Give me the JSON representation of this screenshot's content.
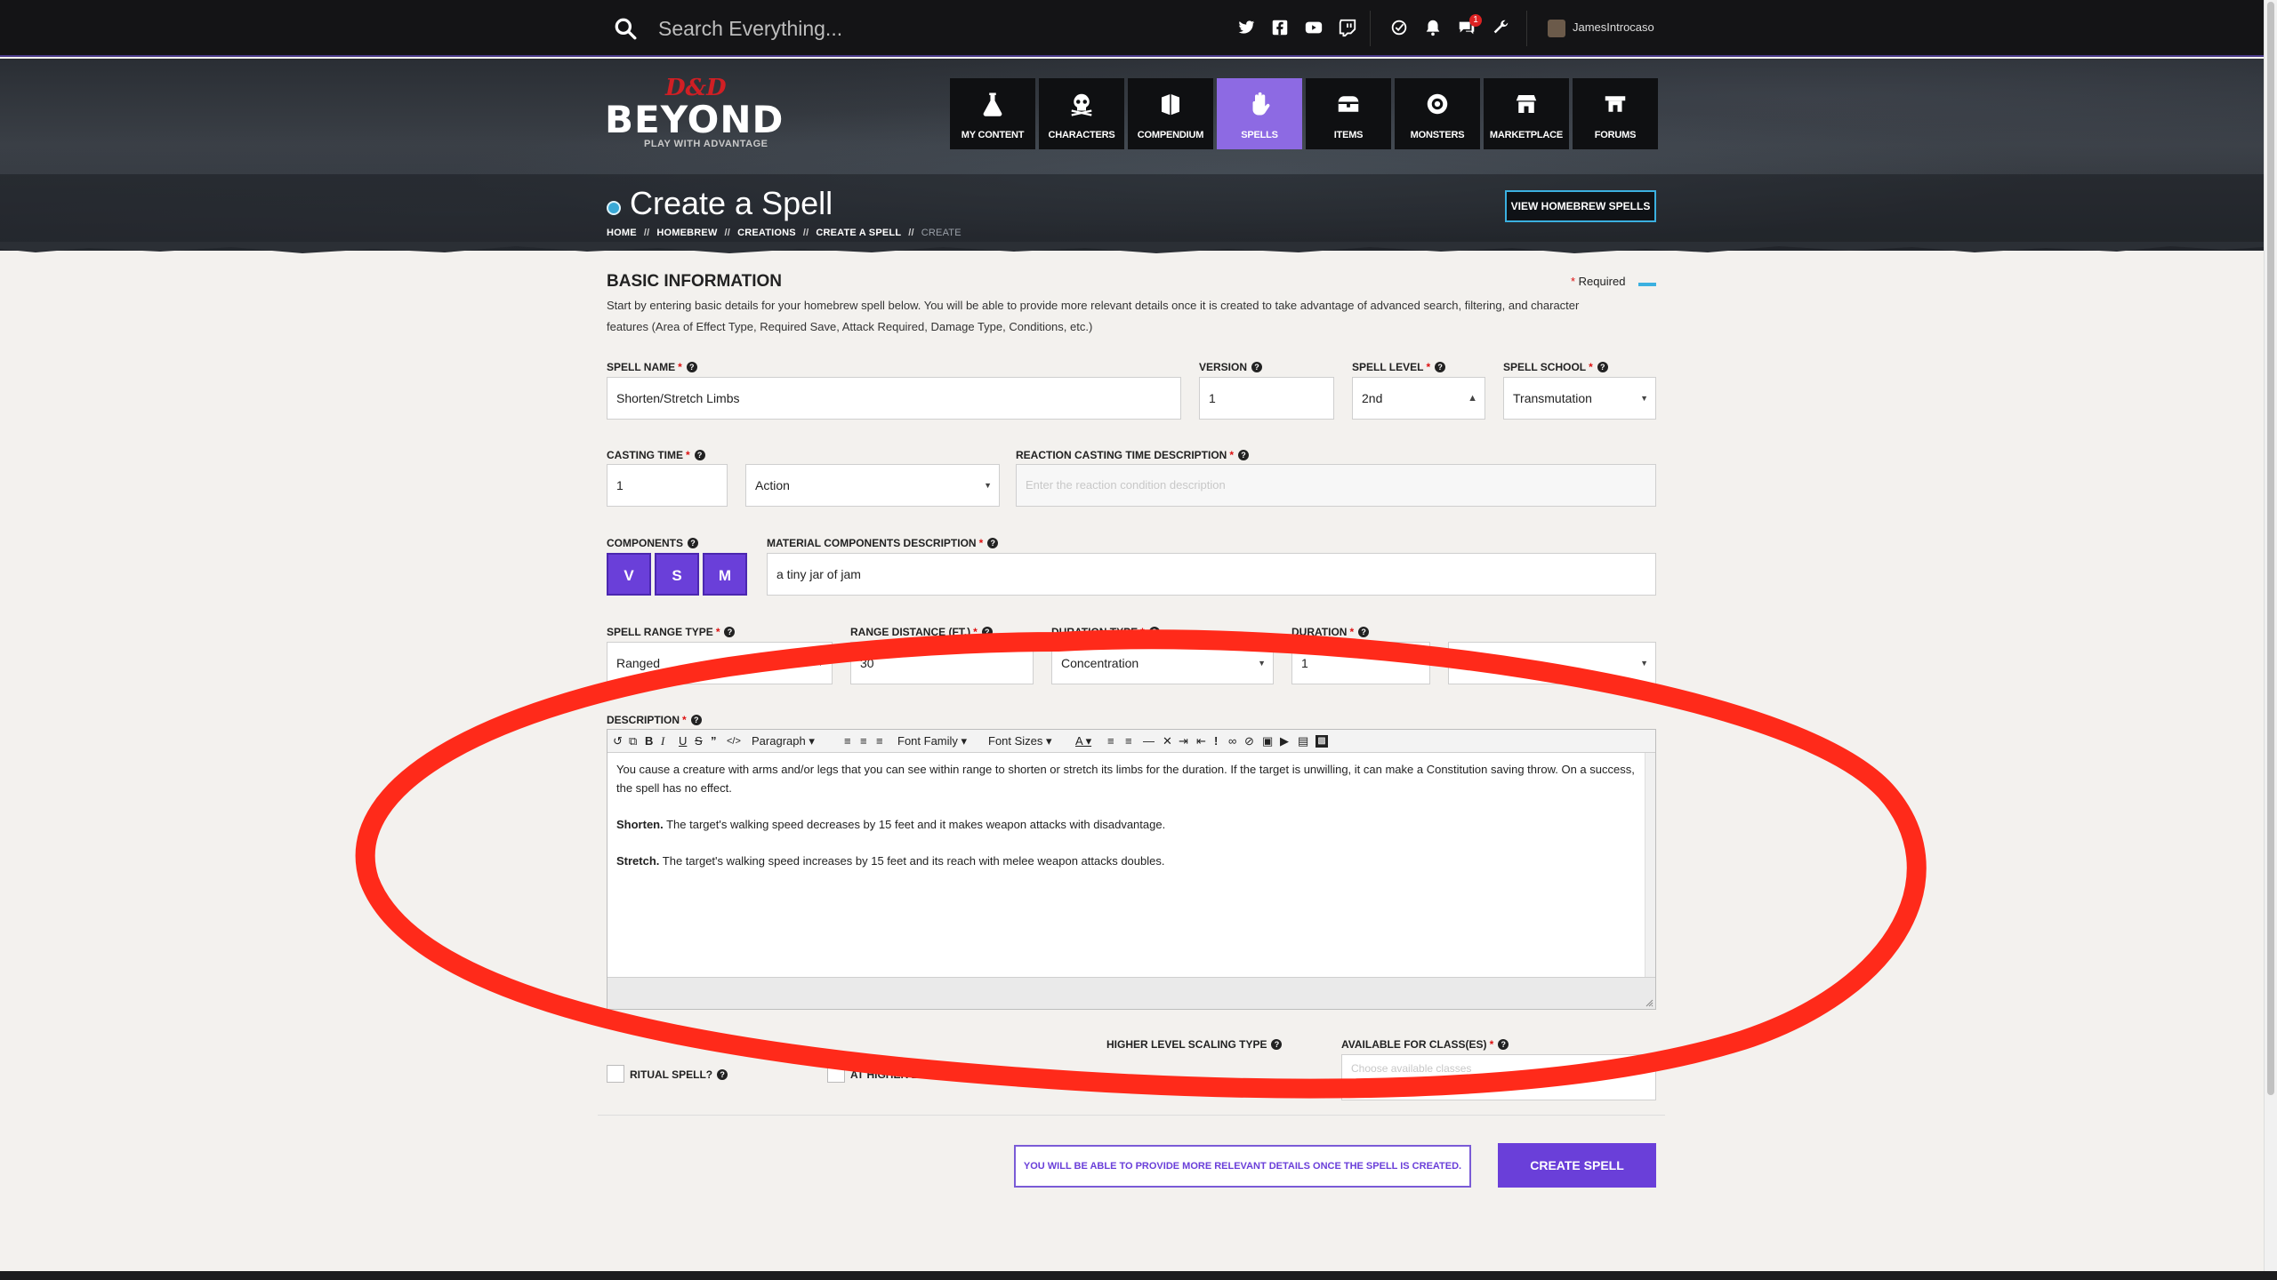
{
  "topbar": {
    "search_placeholder": "Search Everything...",
    "notification_count": "1",
    "username": "JamesIntrocaso"
  },
  "brand": {
    "logo_small": "D&D",
    "logo_main": "BEYOND",
    "tagline": "PLAY WITH ADVANTAGE"
  },
  "nav": [
    {
      "label": "MY CONTENT",
      "icon": "flask-icon"
    },
    {
      "label": "CHARACTERS",
      "icon": "skull-icon"
    },
    {
      "label": "COMPENDIUM",
      "icon": "book-icon"
    },
    {
      "label": "SPELLS",
      "icon": "hand-icon",
      "active": true
    },
    {
      "label": "ITEMS",
      "icon": "chest-icon"
    },
    {
      "label": "MONSTERS",
      "icon": "monster-icon"
    },
    {
      "label": "MARKETPLACE",
      "icon": "shop-icon"
    },
    {
      "label": "FORUMS",
      "icon": "forum-icon"
    }
  ],
  "page": {
    "title": "Create a Spell",
    "breadcrumb": [
      "HOME",
      "HOMEBREW",
      "CREATIONS",
      "CREATE A SPELL",
      "CREATE"
    ],
    "view_homebrew_label": "VIEW HOMEBREW SPELLS"
  },
  "form": {
    "section_title": "BASIC INFORMATION",
    "required_label": "Required",
    "intro_line1": "Start by entering basic details for your homebrew spell below. You will be able to provide more relevant details once it is created to take advantage of advanced search, filtering, and character",
    "intro_line2": "features (Area of Effect Type, Required Save, Attack Required, Damage Type, Conditions, etc.)",
    "spell_name": {
      "label": "SPELL NAME",
      "value": "Shorten/Stretch Limbs"
    },
    "version": {
      "label": "VERSION",
      "value": "1"
    },
    "spell_level": {
      "label": "SPELL LEVEL",
      "value": "2nd"
    },
    "spell_school": {
      "label": "SPELL SCHOOL",
      "value": "Transmutation"
    },
    "casting_time": {
      "label": "CASTING TIME",
      "value": "1",
      "unit": "Action"
    },
    "reaction_desc": {
      "label": "REACTION CASTING TIME DESCRIPTION",
      "placeholder": "Enter the reaction condition description"
    },
    "components": {
      "label": "COMPONENTS",
      "items": [
        "V",
        "S",
        "M"
      ]
    },
    "material_desc": {
      "label": "MATERIAL COMPONENTS DESCRIPTION",
      "value": "a tiny jar of jam"
    },
    "range_type": {
      "label": "SPELL RANGE TYPE",
      "value": "Ranged"
    },
    "range_distance": {
      "label": "RANGE DISTANCE (FT.)",
      "value": "30"
    },
    "duration_type": {
      "label": "DURATION TYPE",
      "value": "Concentration"
    },
    "duration": {
      "label": "DURATION",
      "value": "1",
      "unit": ""
    },
    "description": {
      "label": "DESCRIPTION",
      "toolbar": {
        "paragraph": "Paragraph",
        "font_family": "Font Family",
        "font_sizes": "Font Sizes"
      },
      "p1": "You cause a creature with arms and/or legs that you can see within range to shorten or stretch its limbs for the duration. If the target is unwilling, it can make a Constitution saving throw. On a success, the spell has no effect.",
      "p2_bold": "Shorten.",
      "p2": " The target's walking speed decreases by 15 feet and it makes weapon attacks with disadvantage.",
      "p3_bold": "Stretch.",
      "p3": " The target's walking speed increases by 15 feet and its reach with melee weapon attacks doubles."
    },
    "ritual_label": "RITUAL SPELL?",
    "at_higher_label": "AT HIGHER LEVELS",
    "higher_scaling_label": "HIGHER LEVEL SCALING TYPE",
    "classes": {
      "label": "AVAILABLE FOR CLASS(ES)",
      "placeholder": "Choose available classes"
    },
    "bottom_note": "YOU WILL BE ABLE TO PROVIDE MORE RELEVANT DETAILS ONCE THE SPELL IS CREATED.",
    "create_label": "CREATE SPELL"
  },
  "colors": {
    "accent": "#6a3fd9",
    "active_nav": "#8d6ae3",
    "annotation": "#ff2a1a",
    "brand_red": "#d01f24",
    "link_blue": "#3bb0e0"
  }
}
